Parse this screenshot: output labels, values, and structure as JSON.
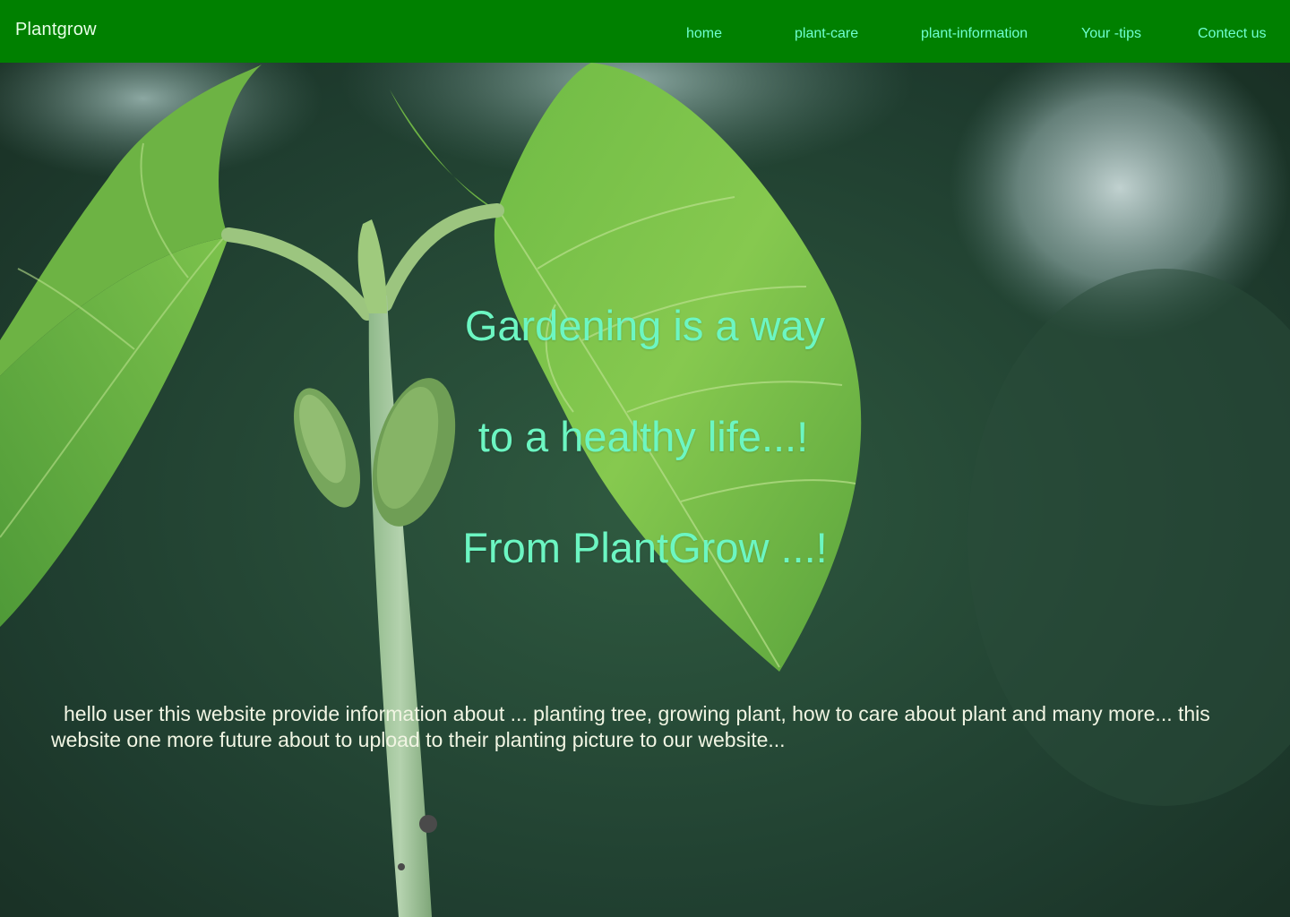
{
  "navbar": {
    "brand": "Plantgrow",
    "links": [
      {
        "label": "home"
      },
      {
        "label": "plant-care"
      },
      {
        "label": "plant-information"
      },
      {
        "label": "Your -tips"
      },
      {
        "label": "Contect us"
      }
    ],
    "background_color": "#008000",
    "link_color": "#6fffd0"
  },
  "hero": {
    "tagline": [
      "Gardening is a way",
      "to a healthy life...!",
      "From PlantGrow ...!"
    ],
    "tagline_color": "#6cf6c2",
    "intro": "hello user this website provide information about ... planting tree, growing plant, how to care about plant and many more... this website one more future about to upload to their planting picture to our website...",
    "intro_color": "#f1f5e3",
    "background_image": "seedling-photo"
  }
}
